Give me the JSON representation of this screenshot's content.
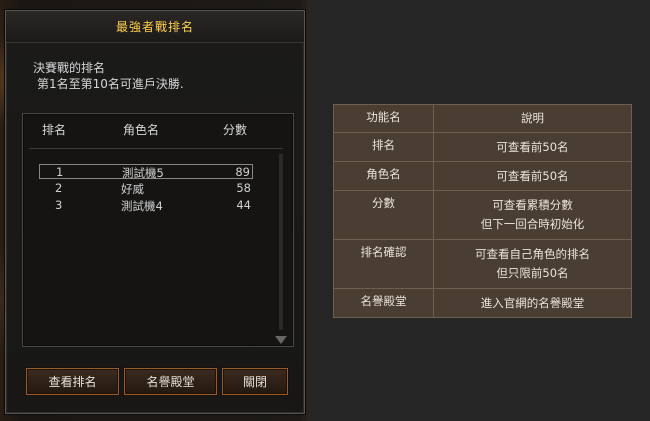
{
  "dialog": {
    "title": "最強者戰排名",
    "intro_line1": "決賽戰的排名",
    "intro_line2": "第1名至第10名可進戶決勝.",
    "columns": {
      "rank": "排名",
      "name": "角色名",
      "score": "分數"
    },
    "rows": [
      {
        "rank": "1",
        "name": "測試機5",
        "score": "89",
        "selected": true
      },
      {
        "rank": "2",
        "name": "好威",
        "score": "58",
        "selected": false
      },
      {
        "rank": "3",
        "name": "測試機4",
        "score": "44",
        "selected": false
      }
    ],
    "buttons": {
      "view_rank": "查看排名",
      "hall_of_fame": "名譽殿堂",
      "close": "關閉"
    }
  },
  "info_table": {
    "header": {
      "key": "功能名",
      "value": "說明"
    },
    "rows": [
      {
        "key": "排名",
        "value_line1": "可查看前50名",
        "value_line2": ""
      },
      {
        "key": "角色名",
        "value_line1": "可查看前50名",
        "value_line2": ""
      },
      {
        "key": "分數",
        "value_line1": "可查看累積分數",
        "value_line2": "但下一回合時初始化"
      },
      {
        "key": "排名確認",
        "value_line1": "可查看自己角色的排名",
        "value_line2": "但只限前50名"
      },
      {
        "key": "名譽殿堂",
        "value_line1": "進入官網的名譽殿堂",
        "value_line2": ""
      }
    ]
  },
  "colors": {
    "title_text": "#ffd04a",
    "button_border": "#9b5a2a",
    "table_bg": "#4a3d31",
    "table_border": "#6e5f50"
  },
  "icons": {
    "scroll_down": "triangle-down-icon"
  }
}
